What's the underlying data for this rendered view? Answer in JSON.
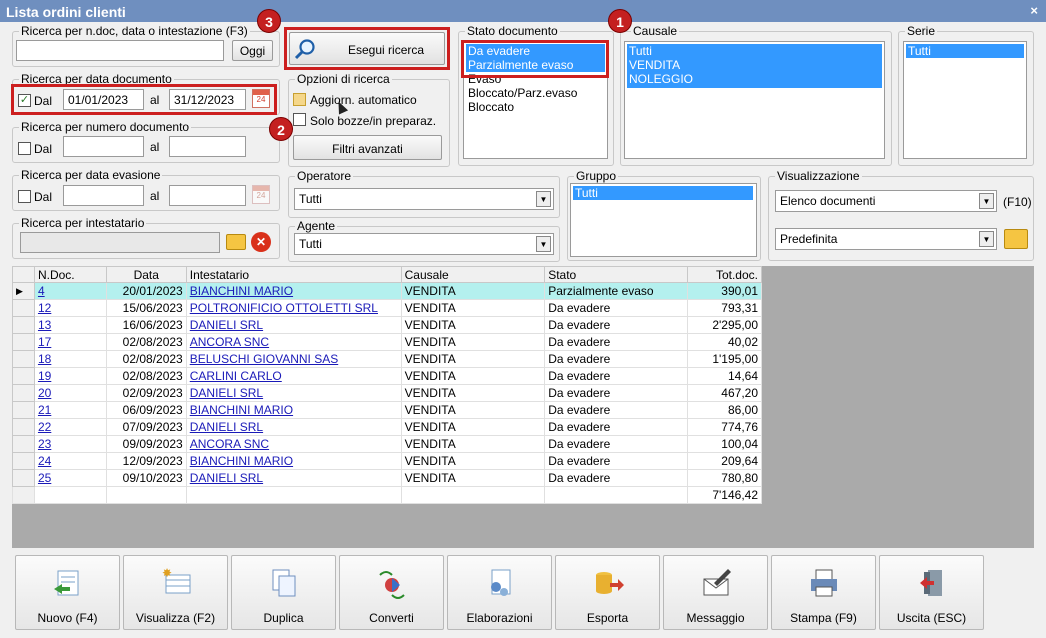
{
  "window": {
    "title": "Lista ordini clienti",
    "close": "×"
  },
  "search_ndoc": {
    "label": "Ricerca per n.doc, data o intestazione (F3)",
    "value": "",
    "today_btn": "Oggi"
  },
  "run_search": {
    "label": "Esegui ricerca"
  },
  "date_doc": {
    "label": "Ricerca per data documento",
    "dal": "Dal",
    "from": "01/01/2023",
    "al": "al",
    "to": "31/12/2023"
  },
  "options": {
    "label": "Opzioni di ricerca",
    "auto": "Aggiorn. automatico",
    "drafts": "Solo bozze/in preparaz.",
    "advanced": "Filtri avanzati"
  },
  "num_doc": {
    "label": "Ricerca per numero documento",
    "dal": "Dal",
    "al": "al"
  },
  "date_eva": {
    "label": "Ricerca per data evasione",
    "dal": "Dal",
    "al": "al"
  },
  "holder": {
    "label": "Ricerca per intestatario"
  },
  "stato": {
    "label": "Stato documento",
    "items": [
      "Da evadere",
      "Parzialmente evaso",
      "Evaso",
      "Bloccato/Parz.evaso",
      "Bloccato"
    ]
  },
  "causale": {
    "label": "Causale",
    "items": [
      "Tutti",
      "VENDITA",
      "NOLEGGIO"
    ]
  },
  "serie": {
    "label": "Serie",
    "items": [
      "Tutti"
    ]
  },
  "operatore": {
    "label": "Operatore",
    "value": "Tutti"
  },
  "agente": {
    "label": "Agente",
    "value": "Tutti"
  },
  "gruppo": {
    "label": "Gruppo",
    "items": [
      "Tutti"
    ]
  },
  "visual": {
    "label": "Visualizzazione",
    "view": "Elenco documenti",
    "key": "(F10)",
    "layout": "Predefinita"
  },
  "badges": [
    "1",
    "2",
    "3"
  ],
  "grid": {
    "headers": [
      "N.Doc.",
      "Data",
      "Intestatario",
      "Causale",
      "Stato",
      "Tot.doc."
    ],
    "rows": [
      [
        "4",
        "20/01/2023",
        "BIANCHINI MARIO",
        "VENDITA",
        "Parzialmente evaso",
        "390,01"
      ],
      [
        "12",
        "15/06/2023",
        "POLTRONIFICIO OTTOLETTI SRL",
        "VENDITA",
        "Da evadere",
        "793,31"
      ],
      [
        "13",
        "16/06/2023",
        "DANIELI SRL",
        "VENDITA",
        "Da evadere",
        "2'295,00"
      ],
      [
        "17",
        "02/08/2023",
        "ANCORA SNC",
        "VENDITA",
        "Da evadere",
        "40,02"
      ],
      [
        "18",
        "02/08/2023",
        "BELUSCHI GIOVANNI SAS",
        "VENDITA",
        "Da evadere",
        "1'195,00"
      ],
      [
        "19",
        "02/08/2023",
        "CARLINI CARLO",
        "VENDITA",
        "Da evadere",
        "14,64"
      ],
      [
        "20",
        "02/09/2023",
        "DANIELI SRL",
        "VENDITA",
        "Da evadere",
        "467,20"
      ],
      [
        "21",
        "06/09/2023",
        "BIANCHINI MARIO",
        "VENDITA",
        "Da evadere",
        "86,00"
      ],
      [
        "22",
        "07/09/2023",
        "DANIELI SRL",
        "VENDITA",
        "Da evadere",
        "774,76"
      ],
      [
        "23",
        "09/09/2023",
        "ANCORA SNC",
        "VENDITA",
        "Da evadere",
        "100,04"
      ],
      [
        "24",
        "12/09/2023",
        "BIANCHINI MARIO",
        "VENDITA",
        "Da evadere",
        "209,64"
      ],
      [
        "25",
        "09/10/2023",
        "DANIELI SRL",
        "VENDITA",
        "Da evadere",
        "780,80"
      ]
    ],
    "total": "7'146,42"
  },
  "toolbar": [
    {
      "label": "Nuovo (F4)",
      "icon": "new-doc-icon"
    },
    {
      "label": "Visualizza (F2)",
      "icon": "view-icon"
    },
    {
      "label": "Duplica",
      "icon": "duplicate-icon"
    },
    {
      "label": "Converti",
      "icon": "convert-icon"
    },
    {
      "label": "Elaborazioni",
      "icon": "process-icon"
    },
    {
      "label": "Esporta",
      "icon": "export-icon"
    },
    {
      "label": "Messaggio",
      "icon": "message-icon"
    },
    {
      "label": "Stampa (F9)",
      "icon": "print-icon"
    },
    {
      "label": "Uscita (ESC)",
      "icon": "exit-icon"
    }
  ]
}
